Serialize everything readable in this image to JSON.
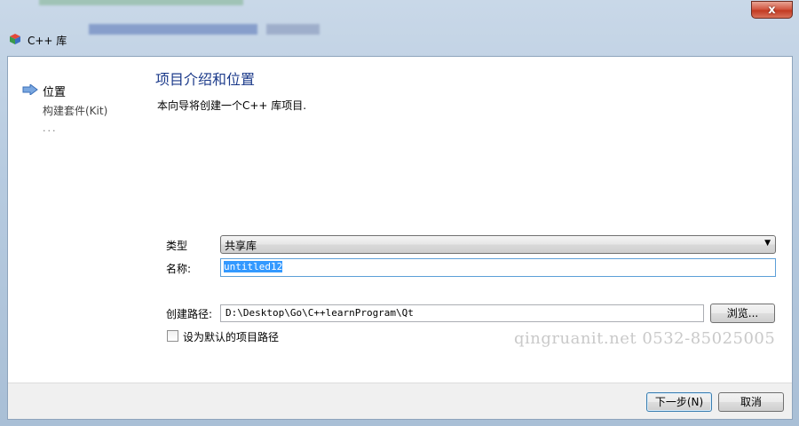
{
  "window": {
    "title": "C++ 库",
    "close_label": "x"
  },
  "sidebar": {
    "items": [
      {
        "label": "位置",
        "active": true
      },
      {
        "label": "构建套件(Kit)"
      },
      {
        "label": "..."
      }
    ]
  },
  "main": {
    "title": "项目介绍和位置",
    "description": "本向导将创建一个C++ 库项目."
  },
  "form": {
    "type_label": "类型",
    "type_value": "共享库",
    "name_label": "名称:",
    "name_value": "untitled12",
    "path_label": "创建路径:",
    "path_value": "D:\\Desktop\\Go\\C++learnProgram\\Qt",
    "browse_label": "浏览...",
    "default_checkbox_label": "设为默认的项目路径",
    "default_checked": false
  },
  "watermark": "qingruanit.net 0532-85025005",
  "footer": {
    "next_label": "下一步(N)",
    "cancel_label": "取消"
  },
  "colors": {
    "title_blue": "#1b3a8a",
    "selection": "#3399ff",
    "close_red": "#c23a22"
  }
}
